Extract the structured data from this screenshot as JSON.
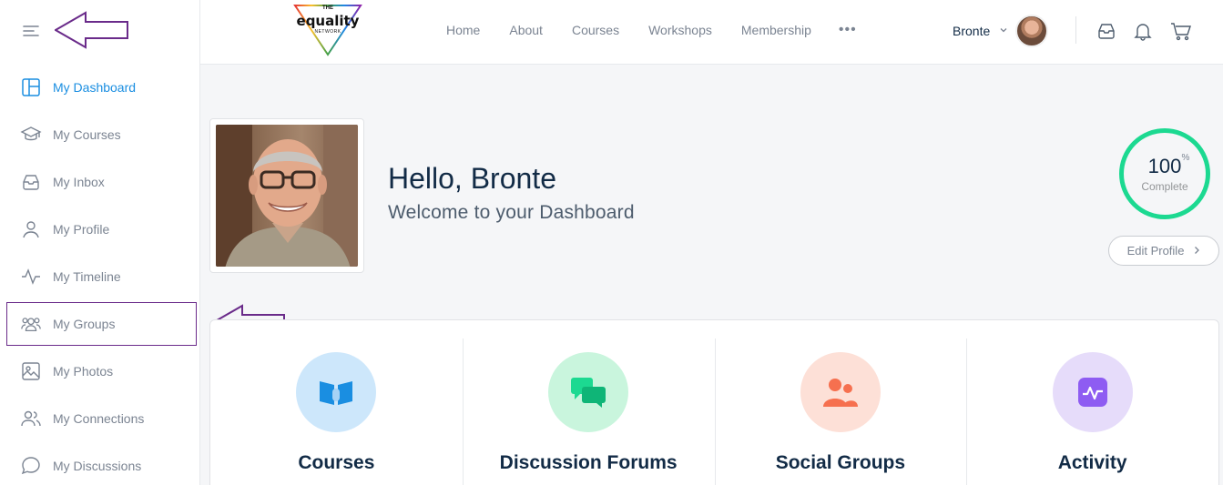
{
  "logo": {
    "the": "THE",
    "name": "equality",
    "network": "NETWORK"
  },
  "sidebar": {
    "items": [
      {
        "label": "My Dashboard",
        "icon": "dashboard-icon",
        "active": true
      },
      {
        "label": "My Courses",
        "icon": "graduation-cap-icon"
      },
      {
        "label": "My Inbox",
        "icon": "inbox-icon"
      },
      {
        "label": "My Profile",
        "icon": "user-icon"
      },
      {
        "label": "My Timeline",
        "icon": "activity-pulse-icon"
      },
      {
        "label": "My Groups",
        "icon": "groups-icon",
        "highlighted": true
      },
      {
        "label": "My Photos",
        "icon": "image-icon"
      },
      {
        "label": "My Connections",
        "icon": "connections-icon"
      },
      {
        "label": "My Discussions",
        "icon": "chat-bubble-icon"
      }
    ]
  },
  "header": {
    "nav": [
      "Home",
      "About",
      "Courses",
      "Workshops",
      "Membership"
    ],
    "more": "•••",
    "user_name": "Bronte"
  },
  "hero": {
    "hello": "Hello,",
    "name": "Bronte",
    "welcome": "Welcome to your Dashboard",
    "progress_value": "100",
    "progress_unit": "%",
    "progress_label": "Complete",
    "edit_profile": "Edit Profile"
  },
  "cards": [
    {
      "title": "Courses",
      "bg": "#cde7fb",
      "color": "#1a8ee1",
      "icon": "book-icon"
    },
    {
      "title": "Discussion Forums",
      "bg": "#c9f5dd",
      "color": "#1cd991",
      "icon": "forum-icon"
    },
    {
      "title": "Social Groups",
      "bg": "#fde0d7",
      "color": "#f6704f",
      "icon": "social-groups-icon"
    },
    {
      "title": "Activity",
      "bg": "#e6dcfa",
      "color": "#8e5cf2",
      "icon": "activity-icon"
    }
  ],
  "colors": {
    "accent": "#1a8ee1",
    "annotation": "#6a2b8a",
    "progress": "#1cd991"
  }
}
